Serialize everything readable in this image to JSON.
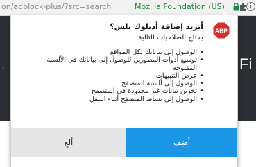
{
  "browser": {
    "url": "on/adblock-plus/?src=search",
    "identity": "Mozilla Foundation (US)",
    "info_symbol": "i"
  },
  "page": {
    "heading_fragment": "Fi",
    "chevron": "‹"
  },
  "popup": {
    "icon_label": "ABP",
    "title": "أتريد إضافة أدبلوك بلس؟",
    "subtitle": "يحتاج الصلاحيات التالية:",
    "permissions": [
      "الوصول إلى بياناتك لكل المواقع",
      "توسيع أدوات المطورين للوصول إلى بياناتك في الألسنة المفتوحة",
      "عرض التنبيهات",
      "الوصول إلى ألسنة المتصفح",
      "تخزين بيانات غير محدودة في المتصفح",
      "الوصول إلى نشاط المتصفح أثناء التنقل"
    ],
    "add_label": "أضِف",
    "cancel_label": "ألغِ"
  },
  "colors": {
    "accent": "#1a96e6",
    "abp_red": "#d7302b",
    "identity_green": "#1b8a3e",
    "page_dark": "#2b2f33"
  }
}
